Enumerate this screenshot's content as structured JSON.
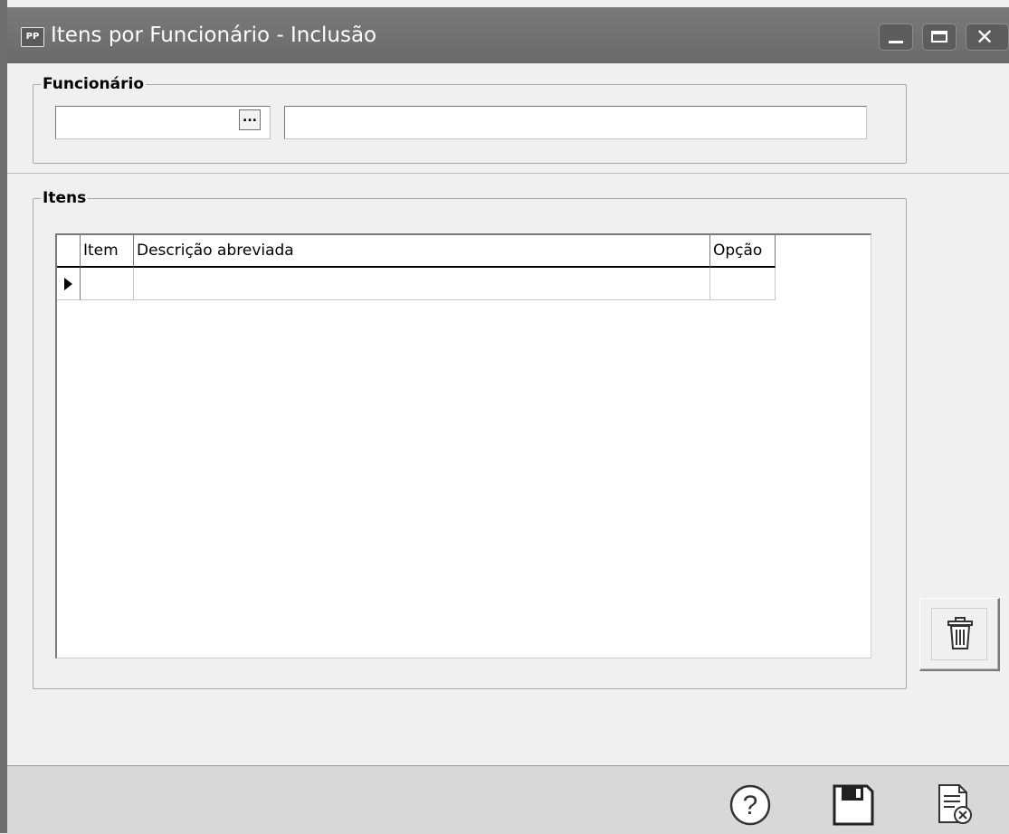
{
  "window": {
    "app_icon_text": "PP",
    "title": "Itens por Funcionário - Inclusão"
  },
  "funcionario_group": {
    "legend": "Funcionário",
    "codigo_value": "",
    "nome_value": "",
    "lookup_label": "..."
  },
  "itens_group": {
    "legend": "Itens",
    "columns": [
      "Item",
      "Descrição abreviada",
      "Opção"
    ],
    "rows": [
      {
        "item": "",
        "descricao": "",
        "opcao": ""
      }
    ]
  },
  "icons": {
    "trash": "trash-icon",
    "help": "help-icon",
    "save": "save-icon",
    "cancel": "cancel-document-icon"
  }
}
